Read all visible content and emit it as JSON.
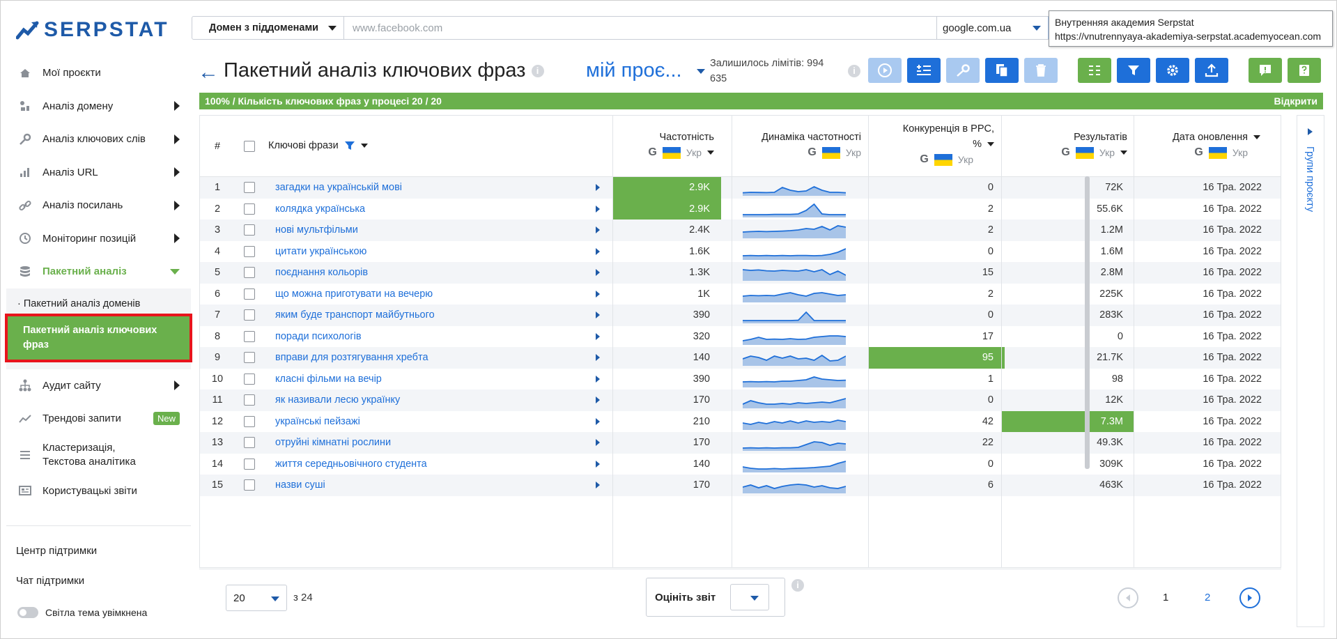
{
  "brand": {
    "name": "SERPSTAT"
  },
  "sidebar": {
    "items": [
      {
        "label": "Мої проєкти",
        "icon": "home-icon"
      },
      {
        "label": "Аналіз домену",
        "icon": "domain-icon"
      },
      {
        "label": "Аналіз ключових слів",
        "icon": "key-icon"
      },
      {
        "label": "Аналіз URL",
        "icon": "bar-chart-icon"
      },
      {
        "label": "Аналіз посилань",
        "icon": "link-icon"
      },
      {
        "label": "Моніторинг позицій",
        "icon": "clock-icon"
      },
      {
        "label": "Пакетний аналіз",
        "icon": "database-icon"
      }
    ],
    "subitems": [
      {
        "label": "· Пакетний аналіз доменів"
      },
      {
        "label": "Пакетний аналіз ключових фраз"
      }
    ],
    "items2": [
      {
        "label": "Аудит сайту",
        "icon": "sitemap-icon"
      },
      {
        "label": "Трендові запити",
        "icon": "trend-icon",
        "badge": "New"
      },
      {
        "label": "Кластеризація, Текстова аналітика",
        "icon": "cluster-icon"
      },
      {
        "label": "Користувацькі звіти",
        "icon": "report-icon"
      }
    ],
    "support_center": "Центр підтримки",
    "support_chat": "Чат підтримки",
    "theme_toggle": "Світла тема увімкнена"
  },
  "search": {
    "scope": "Домен з піддоменами",
    "placeholder": "www.facebook.com",
    "database": "google.com.ua"
  },
  "tooltip": {
    "line1": "Внутренняя академия Serpstat",
    "line2": "https://vnutrennyaya-akademiya-serpstat.academyocean.com"
  },
  "header": {
    "title": "Пакетний аналіз ключових фраз",
    "project": "мій проє...",
    "limits_label": "Залишилось лімітів: 994",
    "limits_value": "635"
  },
  "toolbar": {
    "buttons": [
      {
        "name": "play-button",
        "icon": "play-icon"
      },
      {
        "name": "add-keywords-button",
        "icon": "add-list-icon"
      },
      {
        "name": "keys-button",
        "icon": "key-icon"
      },
      {
        "name": "copy-button",
        "icon": "copy-icon"
      },
      {
        "name": "delete-button",
        "icon": "trash-icon"
      },
      {
        "name": "columns-button",
        "icon": "columns-icon"
      },
      {
        "name": "filter-button",
        "icon": "filter-icon"
      },
      {
        "name": "settings-button",
        "icon": "gear-icon"
      },
      {
        "name": "export-button",
        "icon": "upload-icon"
      },
      {
        "name": "feedback-button",
        "icon": "exclamation-icon"
      },
      {
        "name": "help-button",
        "icon": "question-icon"
      }
    ]
  },
  "progress": {
    "text": "100% / Кількість ключових фраз у процесі 20 / 20",
    "percent": 100,
    "open_label": "Відкрити"
  },
  "table": {
    "columns": {
      "num": "#",
      "keyword": "Ключові фрази",
      "volume": "Частотність",
      "trend": "Динаміка частотності",
      "cpc_line1": "Конкуренція в PPC,",
      "cpc_line2": "%",
      "results": "Результатів",
      "date": "Дата оновлення",
      "source_g": "G",
      "source_lang": "Укр"
    },
    "rows": [
      {
        "n": "1",
        "kw": "загадки на українській мові",
        "vol": "2.9K",
        "cpc": "0",
        "res": "72K",
        "date": "16 Тра. 2022",
        "hl": "vol",
        "trend": [
          0.12,
          0.15,
          0.14,
          0.13,
          0.15,
          0.5,
          0.3,
          0.2,
          0.25,
          0.55,
          0.3,
          0.15,
          0.15,
          0.12
        ]
      },
      {
        "n": "2",
        "kw": "колядка українська",
        "vol": "2.9K",
        "cpc": "2",
        "res": "55.6K",
        "date": "16 Тра. 2022",
        "hl": "vol",
        "trend": [
          0.1,
          0.1,
          0.1,
          0.1,
          0.12,
          0.12,
          0.12,
          0.15,
          0.4,
          0.85,
          0.15,
          0.1,
          0.1,
          0.1
        ]
      },
      {
        "n": "3",
        "kw": "нові мультфільми",
        "vol": "2.4K",
        "cpc": "2",
        "res": "1.2M",
        "date": "16 Тра. 2022",
        "hl": "",
        "trend": [
          0.35,
          0.38,
          0.4,
          0.38,
          0.4,
          0.42,
          0.45,
          0.5,
          0.6,
          0.55,
          0.75,
          0.5,
          0.8,
          0.7
        ]
      },
      {
        "n": "4",
        "kw": "цитати українською",
        "vol": "1.6K",
        "cpc": "0",
        "res": "1.6M",
        "date": "16 Тра. 2022",
        "hl": "",
        "trend": [
          0.2,
          0.22,
          0.2,
          0.22,
          0.2,
          0.22,
          0.2,
          0.22,
          0.22,
          0.2,
          0.22,
          0.3,
          0.45,
          0.7
        ]
      },
      {
        "n": "5",
        "kw": "поєднання кольорів",
        "vol": "1.3K",
        "cpc": "15",
        "res": "2.8M",
        "date": "16 Тра. 2022",
        "hl": "",
        "trend": [
          0.7,
          0.65,
          0.68,
          0.62,
          0.6,
          0.65,
          0.62,
          0.6,
          0.7,
          0.55,
          0.7,
          0.35,
          0.6,
          0.3
        ]
      },
      {
        "n": "6",
        "kw": "що можна приготувати на вечерю",
        "vol": "1K",
        "cpc": "2",
        "res": "225K",
        "date": "16 Тра. 2022",
        "hl": "",
        "trend": [
          0.35,
          0.4,
          0.38,
          0.4,
          0.38,
          0.5,
          0.6,
          0.45,
          0.35,
          0.55,
          0.6,
          0.5,
          0.4,
          0.45
        ]
      },
      {
        "n": "7",
        "kw": "яким буде транспорт майбутнього",
        "vol": "390",
        "cpc": "0",
        "res": "283K",
        "date": "16 Тра. 2022",
        "hl": "",
        "trend": [
          0.1,
          0.1,
          0.1,
          0.1,
          0.1,
          0.1,
          0.1,
          0.12,
          0.7,
          0.1,
          0.1,
          0.1,
          0.1,
          0.1
        ]
      },
      {
        "n": "8",
        "kw": "поради психологів",
        "vol": "320",
        "cpc": "17",
        "res": "0",
        "date": "16 Тра. 2022",
        "hl": "",
        "trend": [
          0.2,
          0.3,
          0.45,
          0.3,
          0.32,
          0.3,
          0.35,
          0.3,
          0.32,
          0.45,
          0.5,
          0.55,
          0.55,
          0.5
        ]
      },
      {
        "n": "9",
        "kw": "вправи для розтягування хребта",
        "vol": "140",
        "cpc": "95",
        "res": "21.7K",
        "date": "16 Тра. 2022",
        "hl": "cpc",
        "trend": [
          0.4,
          0.6,
          0.5,
          0.3,
          0.6,
          0.45,
          0.6,
          0.4,
          0.45,
          0.3,
          0.65,
          0.25,
          0.3,
          0.6
        ]
      },
      {
        "n": "10",
        "kw": "класні фільми на вечір",
        "vol": "390",
        "cpc": "1",
        "res": "98",
        "date": "16 Тра. 2022",
        "hl": "",
        "trend": [
          0.3,
          0.32,
          0.3,
          0.32,
          0.3,
          0.35,
          0.35,
          0.4,
          0.45,
          0.65,
          0.5,
          0.45,
          0.4,
          0.42
        ]
      },
      {
        "n": "11",
        "kw": "як називали лесю українку",
        "vol": "170",
        "cpc": "0",
        "res": "12K",
        "date": "16 Тра. 2022",
        "hl": "",
        "trend": [
          0.2,
          0.45,
          0.3,
          0.2,
          0.2,
          0.25,
          0.2,
          0.3,
          0.25,
          0.3,
          0.35,
          0.3,
          0.45,
          0.6
        ]
      },
      {
        "n": "12",
        "kw": "українські пейзажі",
        "vol": "210",
        "cpc": "42",
        "res": "7.3M",
        "date": "16 Тра. 2022",
        "hl": "res",
        "trend": [
          0.4,
          0.3,
          0.45,
          0.35,
          0.5,
          0.4,
          0.55,
          0.4,
          0.55,
          0.45,
          0.5,
          0.45,
          0.6,
          0.5
        ]
      },
      {
        "n": "13",
        "kw": "отруйні кімнатні рослини",
        "vol": "170",
        "cpc": "22",
        "res": "49.3K",
        "date": "16 Тра. 2022",
        "hl": "",
        "trend": [
          0.1,
          0.12,
          0.1,
          0.12,
          0.1,
          0.12,
          0.12,
          0.15,
          0.35,
          0.55,
          0.5,
          0.3,
          0.45,
          0.4
        ]
      },
      {
        "n": "14",
        "kw": "життя середньовічного студента",
        "vol": "140",
        "cpc": "0",
        "res": "309K",
        "date": "16 Тра. 2022",
        "hl": "",
        "trend": [
          0.3,
          0.2,
          0.15,
          0.15,
          0.18,
          0.15,
          0.18,
          0.2,
          0.22,
          0.25,
          0.3,
          0.35,
          0.55,
          0.7
        ]
      },
      {
        "n": "15",
        "kw": "назви суші",
        "vol": "170",
        "cpc": "6",
        "res": "463K",
        "date": "16 Тра. 2022",
        "hl": "",
        "trend": [
          0.35,
          0.5,
          0.3,
          0.45,
          0.25,
          0.4,
          0.5,
          0.55,
          0.5,
          0.35,
          0.45,
          0.3,
          0.25,
          0.4
        ]
      }
    ]
  },
  "footer": {
    "per_page": "20",
    "of_total": "з 24",
    "rate_label": "Оцініть звіт",
    "page1": "1",
    "page2": "2"
  },
  "right_panel": {
    "label": "Групи проєкту"
  },
  "colors": {
    "accent": "#1e6fd9",
    "brand": "#1e5aa8",
    "green": "#6ab04c",
    "highlight_border": "#e8141c"
  }
}
